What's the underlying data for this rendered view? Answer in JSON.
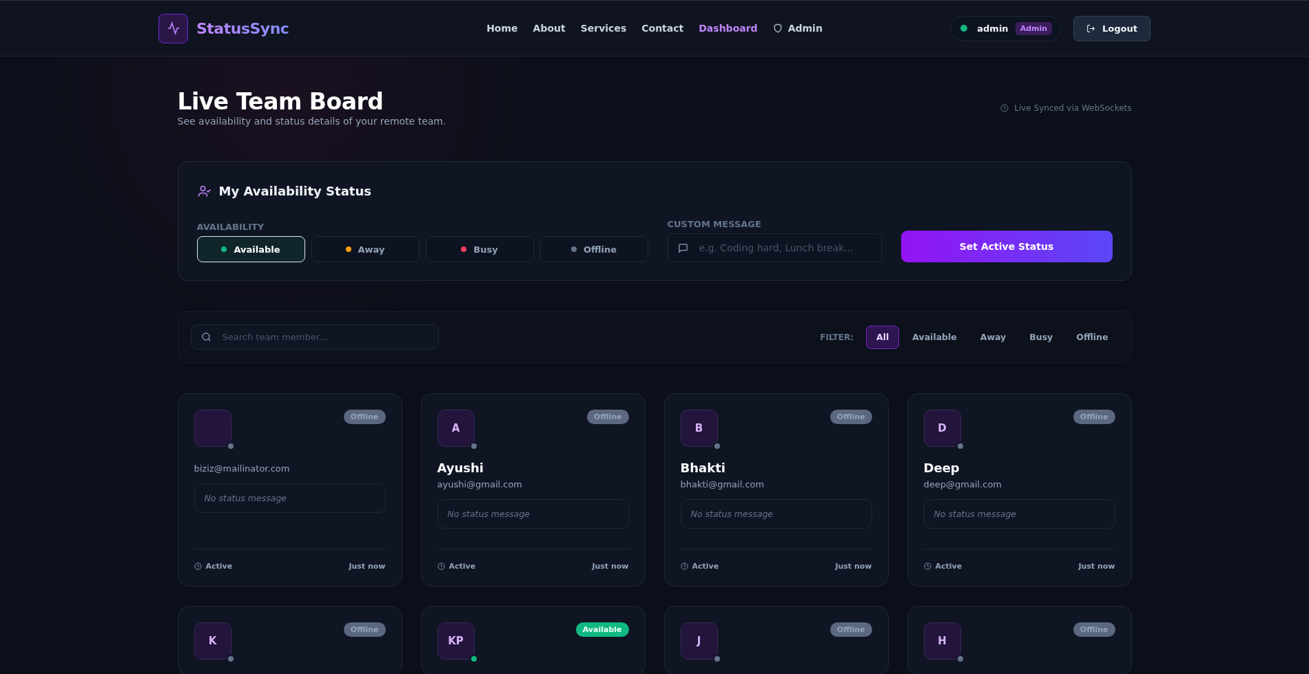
{
  "header": {
    "brand": "StatusSync",
    "nav": [
      {
        "label": "Home",
        "selected": false,
        "kind": "link"
      },
      {
        "label": "About",
        "selected": false,
        "kind": "link"
      },
      {
        "label": "Services",
        "selected": false,
        "kind": "link"
      },
      {
        "label": "Contact",
        "selected": false,
        "kind": "link"
      },
      {
        "label": "Dashboard",
        "selected": true,
        "kind": "link"
      },
      {
        "label": "Admin",
        "selected": false,
        "kind": "admin"
      }
    ],
    "user": {
      "name": "admin",
      "role": "Admin",
      "online": true
    },
    "logout": "Logout"
  },
  "page": {
    "title": "Live Team Board",
    "subtitle": "See availability and status details of your remote team.",
    "sync_note": "Live Synced via WebSockets"
  },
  "my_status": {
    "title": "My Availability Status",
    "availability_label": "AVAILABILITY",
    "options": [
      {
        "label": "Available",
        "color": "#10b981",
        "selected": true
      },
      {
        "label": "Away",
        "color": "#f59e0b",
        "selected": false
      },
      {
        "label": "Busy",
        "color": "#f43f5e",
        "selected": false
      },
      {
        "label": "Offline",
        "color": "#64748b",
        "selected": false
      }
    ],
    "message_label": "CUSTOM MESSAGE",
    "message_placeholder": "e.g. Coding hard, Lunch break...",
    "submit": "Set Active Status"
  },
  "filter_bar": {
    "search_placeholder": "Search team member...",
    "filter_label": "FILTER:",
    "filters": [
      {
        "label": "All",
        "selected": true
      },
      {
        "label": "Available",
        "selected": false
      },
      {
        "label": "Away",
        "selected": false
      },
      {
        "label": "Busy",
        "selected": false
      },
      {
        "label": "Offline",
        "selected": false
      }
    ]
  },
  "members": [
    {
      "kind": "offline",
      "badge": "Offline",
      "email": "biziz@mailinator.com",
      "message": "No status message",
      "activity": "Active",
      "time": "Just now"
    },
    {
      "initials": "A",
      "kind": "offline",
      "badge": "Offline",
      "name": "Ayushi",
      "email": "ayushi@gmail.com",
      "message": "No status message",
      "activity": "Active",
      "time": "Just now"
    },
    {
      "initials": "B",
      "kind": "offline",
      "badge": "Offline",
      "name": "Bhakti",
      "email": "bhakti@gmail.com",
      "message": "No status message",
      "activity": "Active",
      "time": "Just now"
    },
    {
      "initials": "D",
      "kind": "offline",
      "badge": "Offline",
      "name": "Deep",
      "email": "deep@gmail.com",
      "message": "No status message",
      "activity": "Active",
      "time": "Just now"
    },
    {
      "initials": "K",
      "kind": "offline",
      "badge": "Offline"
    },
    {
      "initials": "KP",
      "kind": "available",
      "badge": "Available"
    },
    {
      "initials": "J",
      "kind": "offline",
      "badge": "Offline"
    },
    {
      "initials": "H",
      "kind": "offline",
      "badge": "Offline"
    }
  ]
}
